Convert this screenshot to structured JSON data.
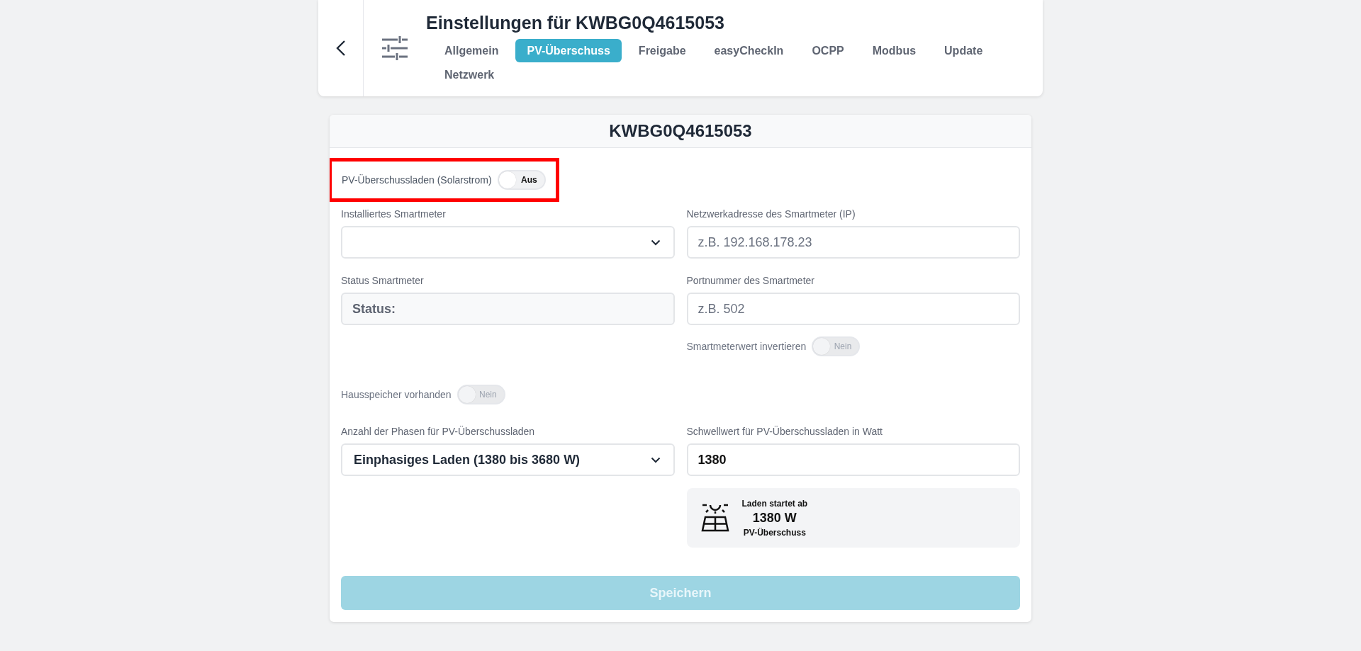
{
  "header": {
    "title": "Einstellungen für KWBG0Q4615053",
    "tabs": [
      {
        "label": "Allgemein",
        "selected": false
      },
      {
        "label": "PV-Überschuss",
        "selected": true
      },
      {
        "label": "Freigabe",
        "selected": false
      },
      {
        "label": "easyCheckIn",
        "selected": false
      },
      {
        "label": "OCPP",
        "selected": false
      },
      {
        "label": "Modbus",
        "selected": false
      },
      {
        "label": "Update",
        "selected": false
      },
      {
        "label": "Netzwerk",
        "selected": false
      }
    ]
  },
  "card": {
    "title": "KWBG0Q4615053"
  },
  "form": {
    "pv_surplus": {
      "label": "PV-Überschussladen (Solarstrom)",
      "highlighted": true,
      "toggle": {
        "text": "Aus",
        "on": false,
        "disabled": false
      }
    },
    "smartmeter_select": {
      "label": "Installiertes Smartmeter"
    },
    "smartmeter_ip": {
      "label": "Netzwerkadresse des Smartmeter (IP)",
      "placeholder": "z.B. 192.168.178.23"
    },
    "status": {
      "label": "Status Smartmeter",
      "value": "Status:"
    },
    "port": {
      "label": "Portnummer des Smartmeter",
      "placeholder": "z.B. 502"
    },
    "invert": {
      "label": "Smartmeterwert invertieren",
      "toggle": {
        "text": "Nein",
        "on": false,
        "disabled": true
      }
    },
    "house_storage": {
      "label": "Hausspeicher vorhanden",
      "toggle": {
        "text": "Nein",
        "on": false,
        "disabled": true
      }
    },
    "phases": {
      "label": "Anzahl der Phasen für PV-Überschussladen",
      "value": "Einphasiges Laden (1380 bis 3680 W)"
    },
    "threshold": {
      "label": "Schwellwert für PV-Überschussladen in Watt",
      "value": "1380"
    },
    "info": {
      "line_1": "Laden startet ab",
      "value": "1380 W",
      "line_3": "PV-Überschuss"
    },
    "save_button": {
      "label": "Speichern",
      "disabled": true
    }
  }
}
